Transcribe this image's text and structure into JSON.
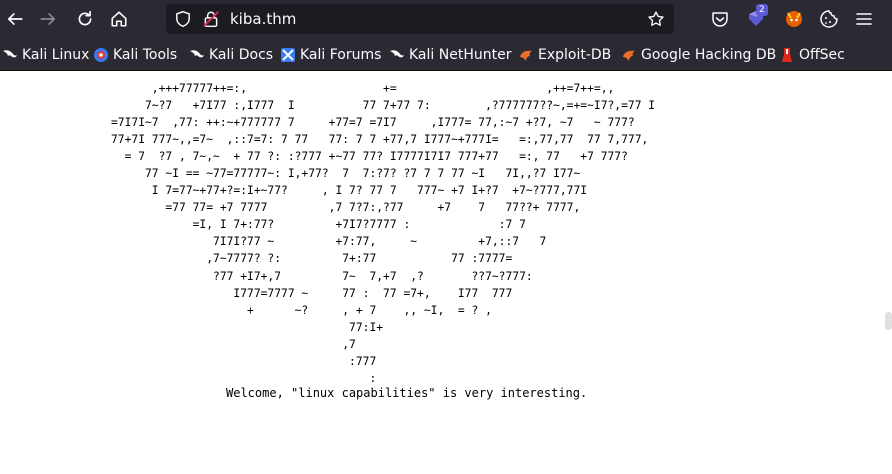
{
  "url": "kiba.thm",
  "toolbar": {
    "extension_badge": "2"
  },
  "bookmarks": [
    {
      "label": "Kali Linux",
      "icon": "kali-dragon-icon"
    },
    {
      "label": "Kali Tools",
      "icon": "kali-tools-icon"
    },
    {
      "label": "Kali Docs",
      "icon": "kali-dragon-icon"
    },
    {
      "label": "Kali Forums",
      "icon": "kali-forums-icon"
    },
    {
      "label": "Kali NetHunter",
      "icon": "kali-dragon-icon"
    },
    {
      "label": "Exploit-DB",
      "icon": "exploit-db-icon"
    },
    {
      "label": "Google Hacking DB",
      "icon": "exploit-db-icon"
    },
    {
      "label": "OffSec",
      "icon": "offsec-icon"
    }
  ],
  "page": {
    "ascii_art": "      ,+++77777++=:,                    +=                      ,++=7++=,,\n     7~?7   +7I77 :,I777  I          77 7+77 7:        ,?777777??~,=+=~I7?,=77 I\n=7I7I~7  ,77: ++:~+777777 7     +77=7 =7I7     ,I777= 77,:~7 +?7, ~7   ~ 777?\n77+7I 777~,,=7~  ,::7=7: 7 77   77: 7 7 +77,7 I777~+777I=   =:,77,77  77 7,777,\n  = 7  ?7 , 7~,~  + 77 ?: :?777 +~77 77? I7777I7I7 777+77   =:, 77   +7 777?\n     77 ~I == ~77=77777~: I,+77?  7  7:?7? ?7 7 7 77 ~I   7I,,?7 I77~\n      I 7=77~+77+?=:I+~77?     , I 7? 77 7   777~ +7 I+?7  +7~?777,77I\n        =77 77= +7 7777         ,7 7?7:,?77     +7    7   77??+ 7777,\n            =I, I 7+:77?         +7I7?7777 :             :7 7\n               7I7I?77 ~         +7:77,     ~         +7,::7   7\n              ,7~7777? ?:         7+:77           77 :7777=\n               ?77 +I7+,7         7~  7,+7  ,?       ??7~?777:\n                  I777=7777 ~     77 :  77 =7+,    I77  777\n                    +      ~?     , + 7    ,, ~I,  = ? ,\n                                   77:I+\n                                  ,7\n                                   :777\n                                      :",
    "welcome": "Welcome, \"linux capabilities\" is very interesting."
  }
}
